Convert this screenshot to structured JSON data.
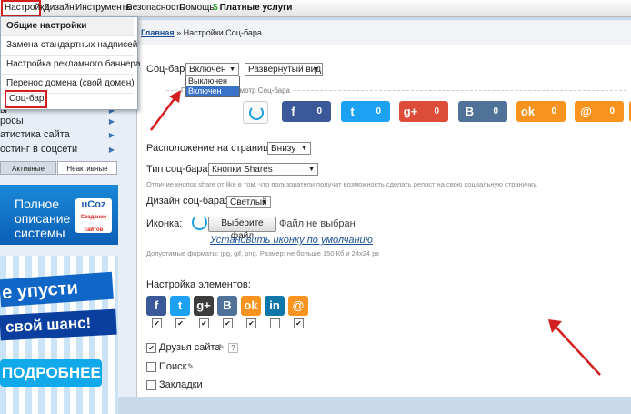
{
  "topbar": {
    "items": [
      "Настройки",
      "Дизайн",
      "Инструменты",
      "Безопасность",
      "Помощь",
      "Платные услуги"
    ],
    "paid_icon": "dollar-icon"
  },
  "dropdown": {
    "header": "Общие настройки",
    "items": [
      "Замена стандартных надписей",
      "Настройка рекламного баннера",
      "Перенос домена (свой домен)",
      "Соц-бар"
    ]
  },
  "sidebar": {
    "items": [
      "ы",
      "росы",
      "атистика сайта",
      "остинг в соцсети"
    ],
    "tabs": [
      "Активные",
      "Неактивные"
    ]
  },
  "ad1": {
    "line1": "Полное",
    "line2": "описание",
    "line3": "системы",
    "brand": "uCoz",
    "brand_sub": "Создание сайтов"
  },
  "ad2": {
    "line1": "е упусти",
    "line2": "свой шанс!",
    "line3": "ПОДРОБНЕЕ"
  },
  "breadcrumb": {
    "home": "Главная",
    "sep": "»",
    "current": "Настройки Соц-бара"
  },
  "socbar": {
    "label": "Соц-бар",
    "value": "Включен",
    "view": "Развернутый вид",
    "options": [
      "Выключен",
      "Включен"
    ],
    "preview_label": "Пре",
    "preview_label2": "смотр Соц-бара"
  },
  "share_buttons": [
    {
      "icon": "f",
      "count": "0",
      "color": "#3b5998",
      "name": "facebook"
    },
    {
      "icon": "t",
      "count": "0",
      "color": "#1da1f2",
      "name": "twitter"
    },
    {
      "icon": "g+",
      "count": "0",
      "color": "#dd4b39",
      "name": "google-plus"
    },
    {
      "icon": "B",
      "count": "0",
      "color": "#507299",
      "name": "vkontakte"
    },
    {
      "icon": "ok",
      "count": "0",
      "color": "#f7931e",
      "name": "odnoklassniki"
    },
    {
      "icon": "@",
      "count": "0",
      "color": "#f7931e",
      "name": "mail-ru"
    },
    {
      "icon": "",
      "count": "",
      "color": "#f7931e",
      "name": "extra"
    }
  ],
  "position": {
    "label": "Расположение на странице:",
    "value": "Внизу"
  },
  "type": {
    "label": "Тип соц-бара:",
    "value": "Кнопки Shares",
    "hint": "Отличие кнопок share от like в том, что пользователи получат возможность сделать репост на свою социальную страничку."
  },
  "design": {
    "label": "Дизайн соц-бара:",
    "value": "Светлый"
  },
  "icon": {
    "label": "Иконка:",
    "button": "Выберите файл",
    "status": "Файл не выбран",
    "default_link": "Установить иконку по умолчанию",
    "hint": "Допустимые форматы: jpg, gif, png. Размер: не больше 150 Кб и 24x24 px"
  },
  "elements": {
    "label": "Настройка элементов:",
    "icons": [
      {
        "icon": "f",
        "color": "#3b5998",
        "name": "facebook"
      },
      {
        "icon": "t",
        "color": "#1da1f2",
        "name": "twitter"
      },
      {
        "icon": "g+",
        "color": "#3d3d3d",
        "name": "google-plus"
      },
      {
        "icon": "B",
        "color": "#507299",
        "name": "vkontakte"
      },
      {
        "icon": "ok",
        "color": "#f7931e",
        "name": "odnoklassniki"
      },
      {
        "icon": "in",
        "color": "#0e76a8",
        "name": "linkedin"
      },
      {
        "icon": "@",
        "color": "#f7931e",
        "name": "mail-ru"
      }
    ],
    "checked": [
      "✔",
      "✔",
      "✔",
      "✔",
      "✔",
      "",
      "✔"
    ]
  },
  "options": [
    {
      "label": "Друзья сайта",
      "checked": "✔"
    },
    {
      "label": "Поиск",
      "checked": ""
    },
    {
      "label": "Закладки",
      "checked": ""
    }
  ]
}
